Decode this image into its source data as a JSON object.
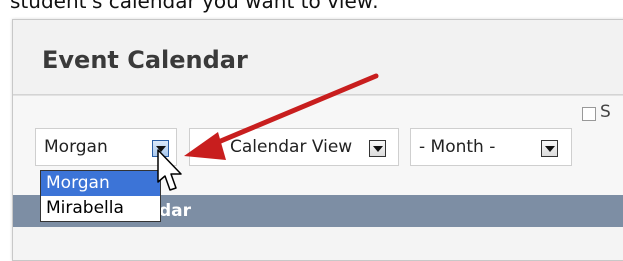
{
  "caption": "student's calendar you want to view:",
  "header": {
    "title": "Event Calendar"
  },
  "toolbar": {
    "student_select": {
      "value": "Morgan",
      "options": [
        "Morgan",
        "Mirabella"
      ],
      "highlighted": "Morgan"
    },
    "view_select": {
      "value": "Calendar View"
    },
    "month_select": {
      "value": "- Month -"
    },
    "truncated_label": "S"
  },
  "calendar_bar": {
    "label": "dar"
  },
  "annotation": {
    "arrow_color": "#c81e1e"
  }
}
